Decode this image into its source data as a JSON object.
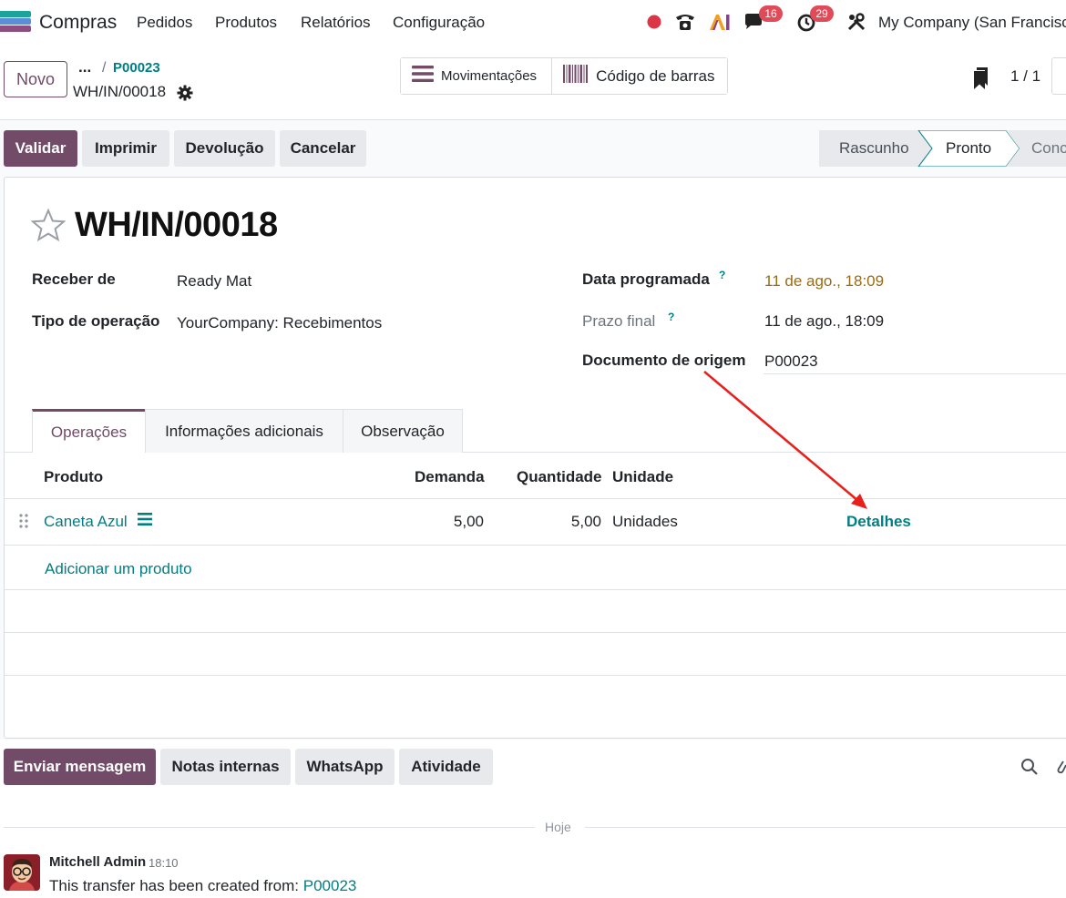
{
  "navbar": {
    "app_name": "Compras",
    "menu": [
      "Pedidos",
      "Produtos",
      "Relatórios",
      "Configuração"
    ],
    "messages_count": "16",
    "activities_count": "29",
    "company": "My Company (San Francisco)"
  },
  "control_panel": {
    "new_label": "Novo",
    "breadcrumb_dots": "...",
    "breadcrumb_sep": "/",
    "breadcrumb_parent": "P00023",
    "current_record": "WH/IN/00018",
    "smart_buttons": [
      "Movimentações",
      "Código de barras"
    ],
    "pager": "1 / 1"
  },
  "actions": {
    "validate": "Validar",
    "print": "Imprimir",
    "return": "Devolução",
    "cancel": "Cancelar"
  },
  "statusbar": {
    "stages": [
      "Rascunho",
      "Pronto",
      "Concluído"
    ],
    "current": "Pronto"
  },
  "form": {
    "title": "WH/IN/00018",
    "fields_left": [
      {
        "label": "Receber de",
        "value": "Ready Mat"
      },
      {
        "label": "Tipo de operação",
        "value": "YourCompany: Recebimentos"
      }
    ],
    "fields_right": [
      {
        "label": "Data programada",
        "help": "?",
        "value": "11 de ago., 18:09"
      },
      {
        "label": "Prazo final",
        "help": "?",
        "value": "11 de ago., 18:09"
      },
      {
        "label": "Documento de origem",
        "value": "P00023"
      }
    ]
  },
  "tabs": [
    "Operações",
    "Informações adicionais",
    "Observação"
  ],
  "table": {
    "headers": [
      "Produto",
      "Demanda",
      "Quantidade",
      "Unidade"
    ],
    "rows": [
      {
        "product": "Caneta Azul",
        "demand": "5,00",
        "quantity": "5,00",
        "unit": "Unidades",
        "details": "Detalhes"
      }
    ],
    "add_line": "Adicionar um produto"
  },
  "chatter": {
    "buttons": [
      "Enviar mensagem",
      "Notas internas",
      "WhatsApp",
      "Atividade"
    ],
    "date_separator": "Hoje",
    "message": {
      "author": "Mitchell Admin",
      "time": "18:10",
      "text": "This transfer has been created from: ",
      "link": "P00023"
    }
  },
  "colors": {
    "primary": "#714B67",
    "link": "#017e84",
    "warning_text": "#9a6b14",
    "badge": "#e04b5a"
  }
}
